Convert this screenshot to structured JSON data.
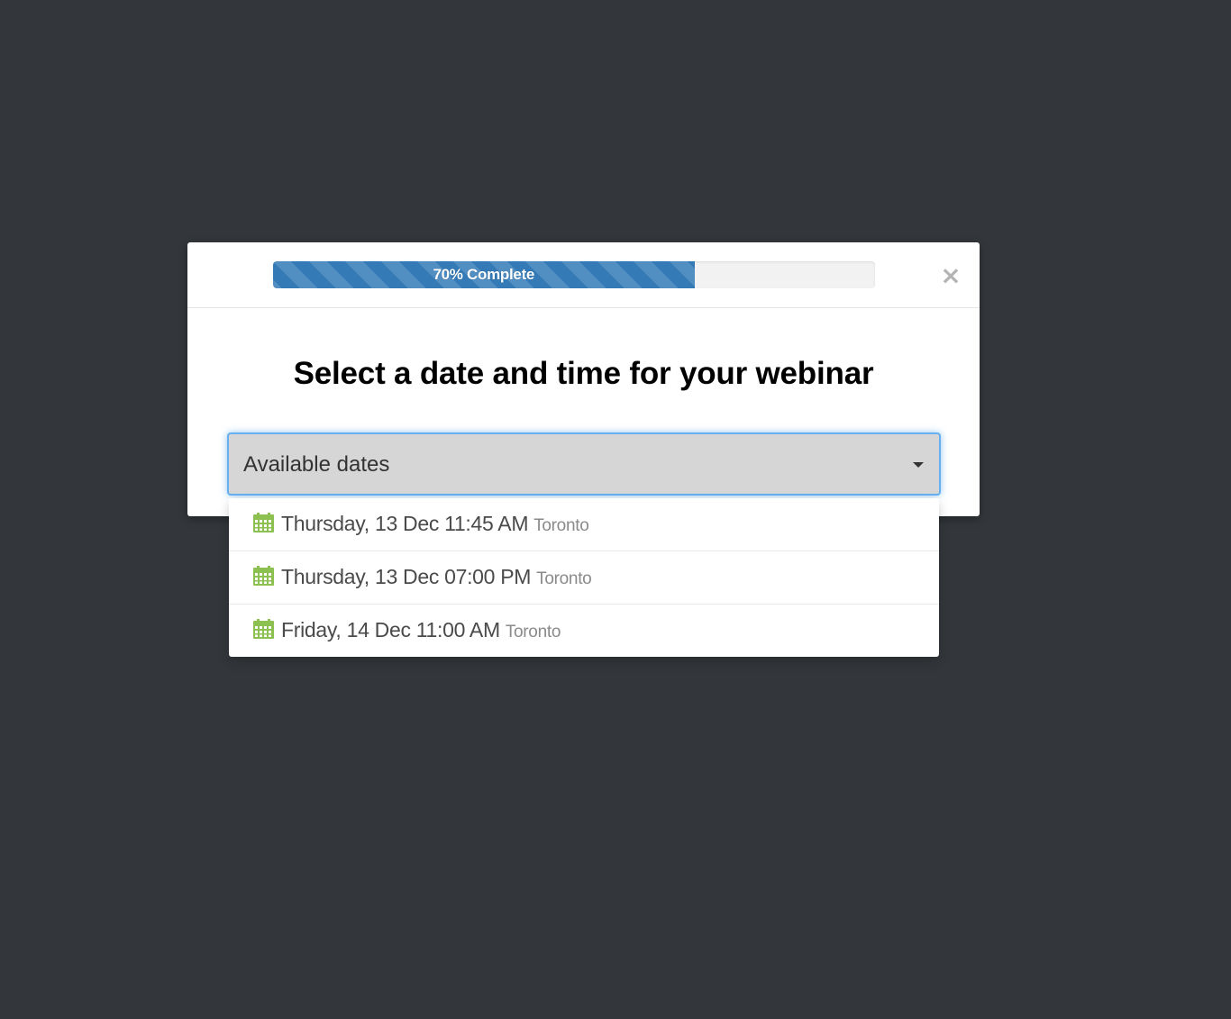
{
  "progress": {
    "label": "70% Complete",
    "percent": 70,
    "color": "#337ab7"
  },
  "close": {
    "label": "×"
  },
  "title": "Select a date and time for your webinar",
  "select": {
    "label": "Available dates",
    "focus_color": "#66aff0"
  },
  "options": [
    {
      "date": "Thursday, 13 Dec 11:45 AM",
      "city": "Toronto",
      "icon": "calendar-icon"
    },
    {
      "date": "Thursday, 13 Dec 07:00 PM",
      "city": "Toronto",
      "icon": "calendar-icon"
    },
    {
      "date": "Friday, 14 Dec 11:00 AM",
      "city": "Toronto",
      "icon": "calendar-icon"
    }
  ],
  "colors": {
    "background": "#33373b",
    "calendar_icon": "#8cc152"
  }
}
